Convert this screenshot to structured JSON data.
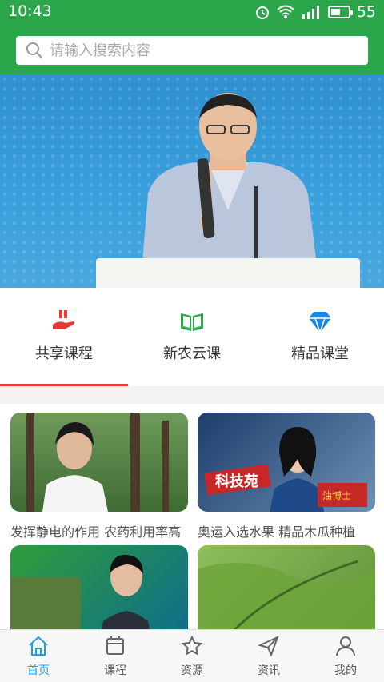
{
  "status_bar": {
    "time": "10:43",
    "battery": "55",
    "battery_level": 0.55
  },
  "search": {
    "placeholder": "请输入搜索内容"
  },
  "categories": [
    {
      "label": "共享课程",
      "icon": "hand-share-icon",
      "color": "#e53935"
    },
    {
      "label": "新农云课",
      "icon": "open-book-icon",
      "color": "#2ca64a"
    },
    {
      "label": "精品课堂",
      "icon": "diamond-icon",
      "color": "#1e88e5"
    }
  ],
  "courses": [
    {
      "title": "发挥静电的作用 农药利用率高"
    },
    {
      "title": "奥运入选水果 精品木瓜种植"
    },
    {
      "title": ""
    },
    {
      "title": ""
    }
  ],
  "nav": [
    {
      "label": "首页",
      "icon": "home-icon",
      "active": true
    },
    {
      "label": "课程",
      "icon": "calendar-icon"
    },
    {
      "label": "资源",
      "icon": "star-icon"
    },
    {
      "label": "资讯",
      "icon": "send-icon"
    },
    {
      "label": "我的",
      "icon": "user-icon"
    }
  ],
  "colors": {
    "header": "#2ca64a",
    "active_nav": "#1aa0e0",
    "tab_underline": "#e53935"
  },
  "banner": {
    "thumb_label": "油博士",
    "logo_text": "科技苑"
  }
}
